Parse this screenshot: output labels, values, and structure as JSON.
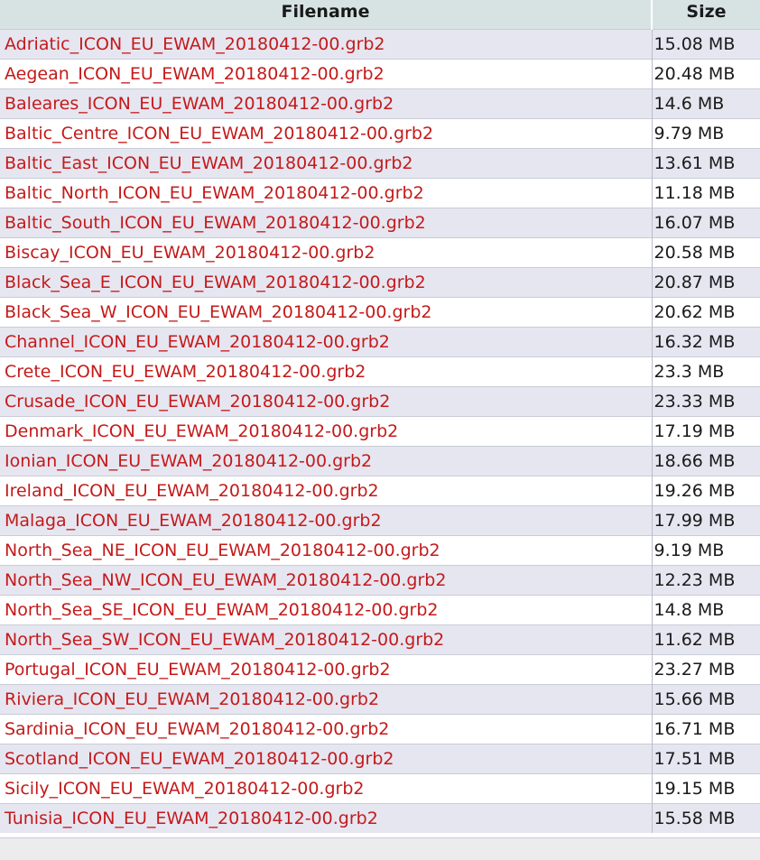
{
  "table": {
    "headers": {
      "filename": "Filename",
      "size": "Size"
    },
    "rows": [
      {
        "name": "Adriatic_ICON_EU_EWAM_20180412-00.grb2",
        "size": "15.08 MB"
      },
      {
        "name": "Aegean_ICON_EU_EWAM_20180412-00.grb2",
        "size": "20.48 MB"
      },
      {
        "name": "Baleares_ICON_EU_EWAM_20180412-00.grb2",
        "size": "14.6 MB"
      },
      {
        "name": "Baltic_Centre_ICON_EU_EWAM_20180412-00.grb2",
        "size": "9.79 MB"
      },
      {
        "name": "Baltic_East_ICON_EU_EWAM_20180412-00.grb2",
        "size": "13.61 MB"
      },
      {
        "name": "Baltic_North_ICON_EU_EWAM_20180412-00.grb2",
        "size": "11.18 MB"
      },
      {
        "name": "Baltic_South_ICON_EU_EWAM_20180412-00.grb2",
        "size": "16.07 MB"
      },
      {
        "name": "Biscay_ICON_EU_EWAM_20180412-00.grb2",
        "size": "20.58 MB"
      },
      {
        "name": "Black_Sea_E_ICON_EU_EWAM_20180412-00.grb2",
        "size": "20.87 MB"
      },
      {
        "name": "Black_Sea_W_ICON_EU_EWAM_20180412-00.grb2",
        "size": "20.62 MB"
      },
      {
        "name": "Channel_ICON_EU_EWAM_20180412-00.grb2",
        "size": "16.32 MB"
      },
      {
        "name": "Crete_ICON_EU_EWAM_20180412-00.grb2",
        "size": "23.3 MB"
      },
      {
        "name": "Crusade_ICON_EU_EWAM_20180412-00.grb2",
        "size": "23.33 MB"
      },
      {
        "name": "Denmark_ICON_EU_EWAM_20180412-00.grb2",
        "size": "17.19 MB"
      },
      {
        "name": "Ionian_ICON_EU_EWAM_20180412-00.grb2",
        "size": "18.66 MB"
      },
      {
        "name": "Ireland_ICON_EU_EWAM_20180412-00.grb2",
        "size": "19.26 MB"
      },
      {
        "name": "Malaga_ICON_EU_EWAM_20180412-00.grb2",
        "size": "17.99 MB"
      },
      {
        "name": "North_Sea_NE_ICON_EU_EWAM_20180412-00.grb2",
        "size": "9.19 MB"
      },
      {
        "name": "North_Sea_NW_ICON_EU_EWAM_20180412-00.grb2",
        "size": "12.23 MB"
      },
      {
        "name": "North_Sea_SE_ICON_EU_EWAM_20180412-00.grb2",
        "size": "14.8 MB"
      },
      {
        "name": "North_Sea_SW_ICON_EU_EWAM_20180412-00.grb2",
        "size": "11.62 MB"
      },
      {
        "name": "Portugal_ICON_EU_EWAM_20180412-00.grb2",
        "size": "23.27 MB"
      },
      {
        "name": "Riviera_ICON_EU_EWAM_20180412-00.grb2",
        "size": "15.66 MB"
      },
      {
        "name": "Sardinia_ICON_EU_EWAM_20180412-00.grb2",
        "size": "16.71 MB"
      },
      {
        "name": "Scotland_ICON_EU_EWAM_20180412-00.grb2",
        "size": "17.51 MB"
      },
      {
        "name": "Sicily_ICON_EU_EWAM_20180412-00.grb2",
        "size": "19.15 MB"
      },
      {
        "name": "Tunisia_ICON_EU_EWAM_20180412-00.grb2",
        "size": "15.58 MB"
      }
    ]
  },
  "colors": {
    "link": "#c41a1a",
    "header_bg": "#d7e3e3",
    "row_alt_bg": "#e6e6f1"
  }
}
